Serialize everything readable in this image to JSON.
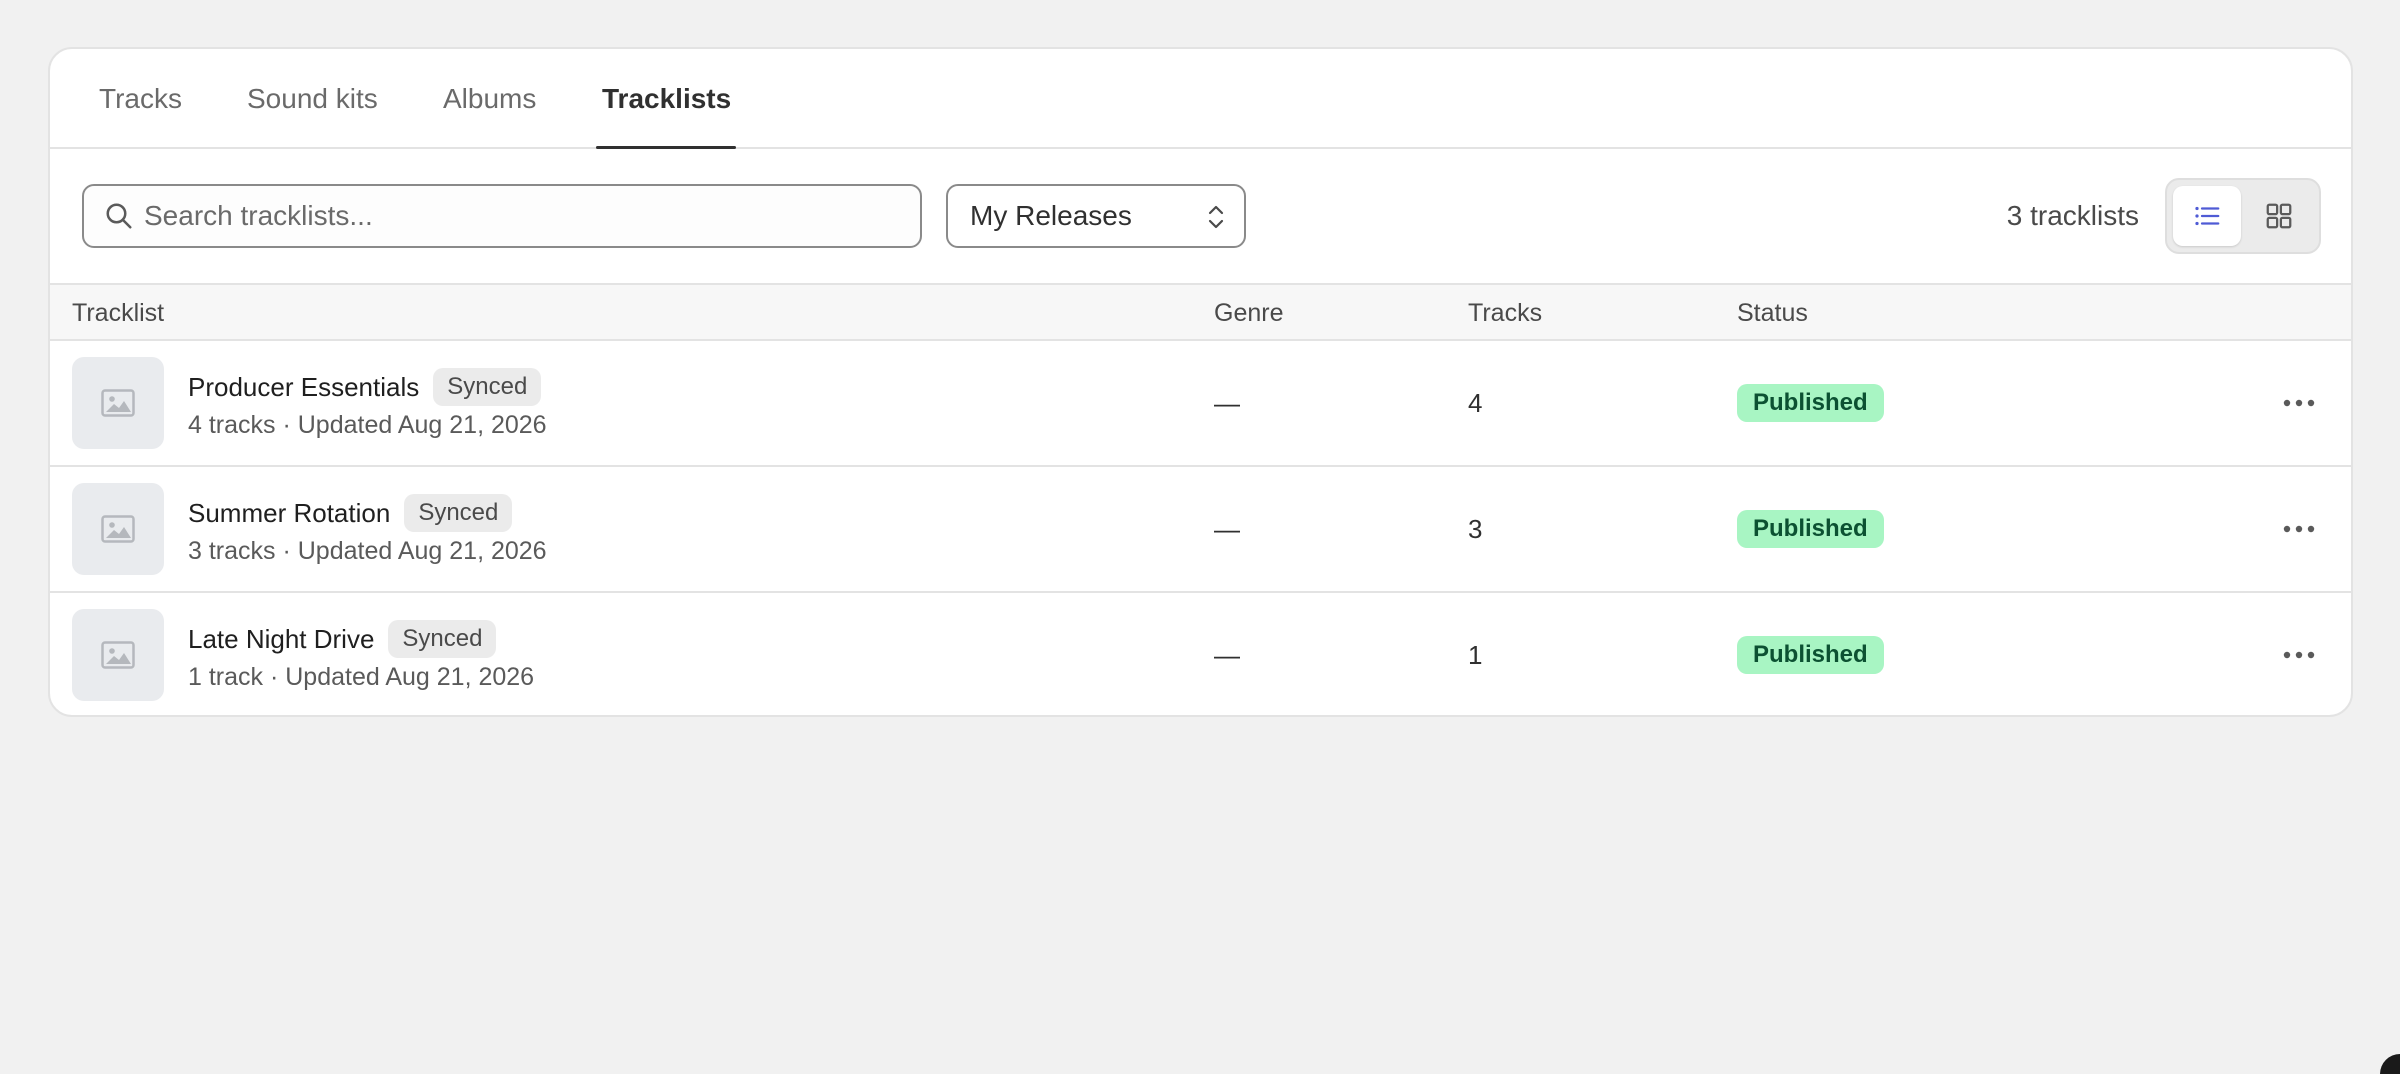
{
  "tabs": [
    {
      "label": "Tracks"
    },
    {
      "label": "Sound kits"
    },
    {
      "label": "Albums"
    },
    {
      "label": "Tracklists"
    }
  ],
  "active_tab": "Tracklists",
  "search": {
    "placeholder": "Search tracklists...",
    "value": ""
  },
  "filter": {
    "selected": "My Releases"
  },
  "count_label": "3 tracklists",
  "view_toggle": {
    "active": "list",
    "options": [
      "list-icon",
      "grid-icon"
    ]
  },
  "table": {
    "headers": {
      "tracklist": "Tracklist",
      "genre": "Genre",
      "tracks": "Tracks",
      "status": "Status"
    },
    "rows": [
      {
        "name": "Producer Essentials",
        "badge": "Synced",
        "meta": "4 tracks · Updated Aug 21, 2026",
        "genre": "—",
        "tracks": "4",
        "status": "Published"
      },
      {
        "name": "Summer Rotation",
        "badge": "Synced",
        "meta": "3 tracks · Updated Aug 21, 2026",
        "genre": "—",
        "tracks": "3",
        "status": "Published"
      },
      {
        "name": "Late Night Drive",
        "badge": "Synced",
        "meta": "1 track · Updated Aug 21, 2026",
        "genre": "—",
        "tracks": "1",
        "status": "Published"
      }
    ]
  },
  "colors": {
    "accent": "#4f5bd5",
    "status_bg": "#a8f5c3",
    "status_text": "#0c5132",
    "page_bg": "#f1f1f1"
  }
}
